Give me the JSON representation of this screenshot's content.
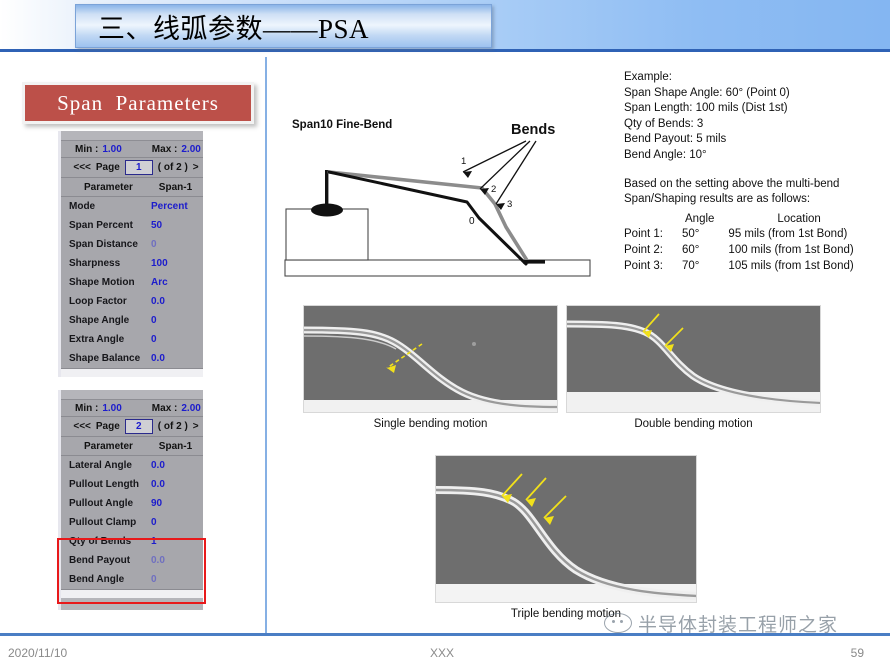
{
  "slide": {
    "title": "三、线弧参数——PSA",
    "caption_box": "Span  Parameters"
  },
  "panel1": {
    "min_label": "Min :",
    "min_value": "1.00",
    "max_label": "Max :",
    "max_value": "2.00",
    "pager_prev": "<<<",
    "pager_word": "Page",
    "page_value": "1",
    "pager_of": "( of 2 )",
    "pager_next": ">",
    "col_header_param": "Parameter",
    "col_header_span": "Span-1",
    "rows": [
      {
        "name": "Mode",
        "value": "Percent",
        "dim": false
      },
      {
        "name": "Span Percent",
        "value": "50",
        "dim": false
      },
      {
        "name": "Span Distance",
        "value": "0",
        "dim": true
      },
      {
        "name": "Sharpness",
        "value": "100",
        "dim": false
      },
      {
        "name": "Shape Motion",
        "value": "Arc",
        "dim": false
      },
      {
        "name": "Loop Factor",
        "value": "0.0",
        "dim": false
      },
      {
        "name": "Shape Angle",
        "value": "0",
        "dim": false
      },
      {
        "name": "Extra Angle",
        "value": "0",
        "dim": false
      },
      {
        "name": "Shape Balance",
        "value": "0.0",
        "dim": false
      }
    ]
  },
  "panel2": {
    "min_label": "Min :",
    "min_value": "1.00",
    "max_label": "Max :",
    "max_value": "2.00",
    "pager_prev": "<<<",
    "pager_word": "Page",
    "page_value": "2",
    "pager_of": "( of 2 )",
    "pager_next": ">",
    "col_header_param": "Parameter",
    "col_header_span": "Span-1",
    "rows": [
      {
        "name": "Lateral Angle",
        "value": "0.0",
        "dim": false
      },
      {
        "name": "Pullout Length",
        "value": "0.0",
        "dim": false
      },
      {
        "name": "Pullout Angle",
        "value": "90",
        "dim": false
      },
      {
        "name": "Pullout Clamp",
        "value": "0",
        "dim": false
      },
      {
        "name": "Qty of Bends",
        "value": "1",
        "dim": false
      },
      {
        "name": "Bend Payout",
        "value": "0.0",
        "dim": true
      },
      {
        "name": "Bend Angle",
        "value": "0",
        "dim": true
      }
    ]
  },
  "diagram": {
    "caption": "Span10 Fine-Bend",
    "bends_label": "Bends",
    "marker_0": "0",
    "marker_1": "1",
    "marker_2": "2",
    "marker_3": "3"
  },
  "example": {
    "lines": [
      "Example:",
      "Span Shape Angle: 60° (Point 0)",
      "Span Length: 100 mils (Dist 1st)",
      "Qty of Bends: 3",
      "Bend Payout: 5 mils",
      "Bend Angle: 10°"
    ],
    "note_lines": [
      "Based on the setting above the multi-bend",
      "Span/Shaping results are as follows:"
    ],
    "table": {
      "header_angle": "Angle",
      "header_location": "Location",
      "rows": [
        {
          "point": "Point 1:",
          "angle": "50°",
          "location": "95 mils (from 1st Bond)"
        },
        {
          "point": "Point 2:",
          "angle": "60°",
          "location": "100 mils (from 1st Bond)"
        },
        {
          "point": "Point 3:",
          "angle": "70°",
          "location": "105 mils (from 1st Bond)"
        }
      ]
    }
  },
  "micrographs": [
    {
      "caption": "Single bending motion"
    },
    {
      "caption": "Double bending motion"
    },
    {
      "caption": "Triple bending motion"
    }
  ],
  "watermark": {
    "text": "半导体封装工程师之家"
  },
  "footer": {
    "date": "2020/11/10",
    "center": "XXX",
    "page": "59"
  },
  "colors": {
    "accent_blue": "#2f62b5",
    "caption_red": "#bc5049",
    "value_blue": "#1c1ccc",
    "highlight_red": "#e8191b",
    "panel_gray": "#a7a7ac"
  }
}
